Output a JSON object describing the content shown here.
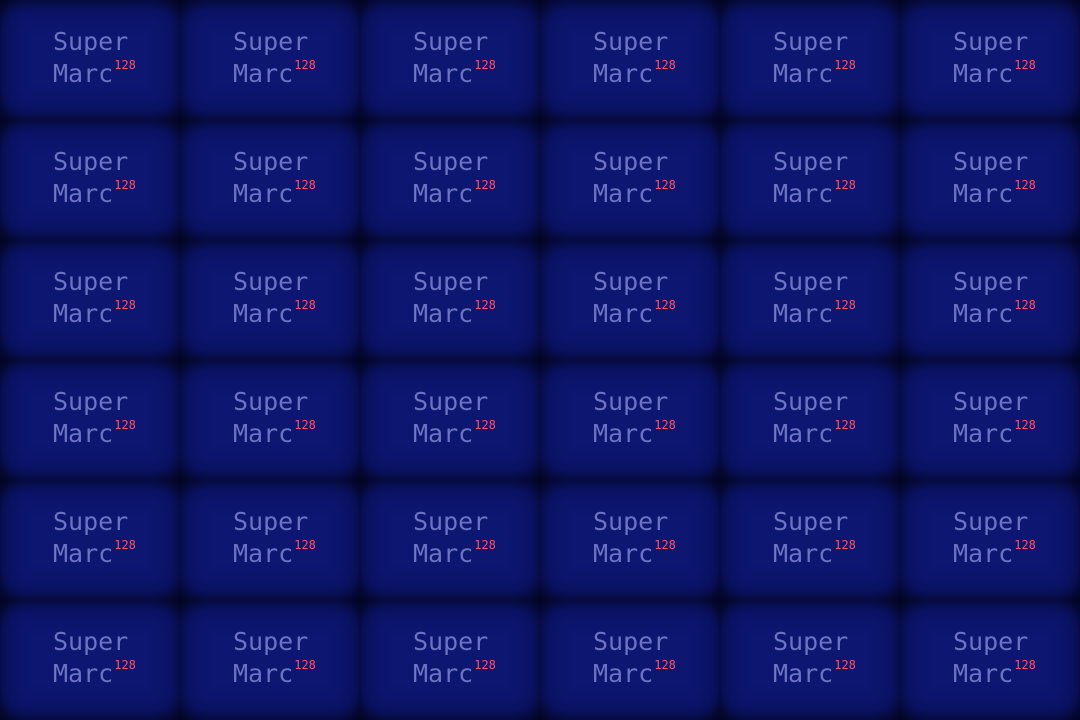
{
  "tile": {
    "line1": "Super",
    "line2": "Marc",
    "superscript": "128"
  },
  "grid": {
    "rows": 6,
    "columns": 6
  },
  "colors": {
    "background": "#03041a",
    "tile_glow": "#0d1670",
    "text": "#6c73c4",
    "superscript": "#ff4f6a"
  }
}
